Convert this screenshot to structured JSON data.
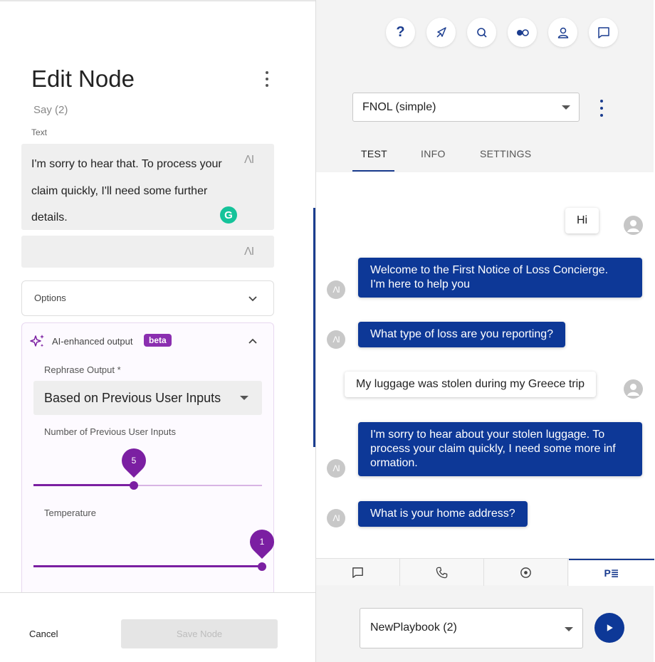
{
  "editor": {
    "title": "Edit Node",
    "subtitle": "Say (2)",
    "text_label": "Text",
    "text_value": "I'm sorry to hear that. To process your claim quickly, I'll need some further details.",
    "ai_mark": "ΛI",
    "grammarly_glyph": "G",
    "options_label": "Options",
    "ai_section": {
      "title": "AI-enhanced output",
      "badge": "beta",
      "rephrase_label": "Rephrase Output *",
      "rephrase_value": "Based on Previous User Inputs",
      "num_inputs_label": "Number of Previous User Inputs",
      "num_inputs_value": "5",
      "num_inputs_fraction": 0.44,
      "temperature_label": "Temperature",
      "temperature_value": "1",
      "temperature_fraction": 1.0
    },
    "footer": {
      "cancel_label": "Cancel",
      "save_label": "Save Node"
    }
  },
  "toolbar": {
    "icons": [
      "help-icon",
      "compass-icon",
      "search-icon",
      "toggle-icon",
      "user-icon",
      "chat-icon"
    ],
    "help_glyph": "?"
  },
  "flow": {
    "selected": "FNOL (simple)",
    "tabs": [
      "TEST",
      "INFO",
      "SETTINGS"
    ],
    "active_tab": "TEST"
  },
  "chat": {
    "bot_avatar": "ΛI",
    "messages": [
      {
        "from": "user",
        "text": "Hi"
      },
      {
        "from": "bot",
        "lines": [
          "Welcome to the First Notice of Loss Concierge.",
          "I'm here to help you"
        ]
      },
      {
        "from": "bot",
        "lines": [
          "What type of loss are you reporting?"
        ]
      },
      {
        "from": "user",
        "text": "My luggage was stolen during my Greece trip"
      },
      {
        "from": "bot",
        "lines": [
          "I'm sorry to hear about your stolen luggage. To",
          "process your claim quickly, I need some more inf",
          "ormation."
        ]
      },
      {
        "from": "bot",
        "lines": [
          "What is your home address?"
        ]
      }
    ]
  },
  "bottom_tabs": [
    "chat-icon",
    "phone-icon",
    "target-icon",
    "playbook-icon"
  ],
  "bottom_tab_playbook_label": "P≣",
  "playbook": {
    "selected": "NewPlaybook (2)"
  },
  "colors": {
    "brand_blue": "#0d3897",
    "ai_purple": "#7b1fa2",
    "grammarly_green": "#15c39a"
  }
}
